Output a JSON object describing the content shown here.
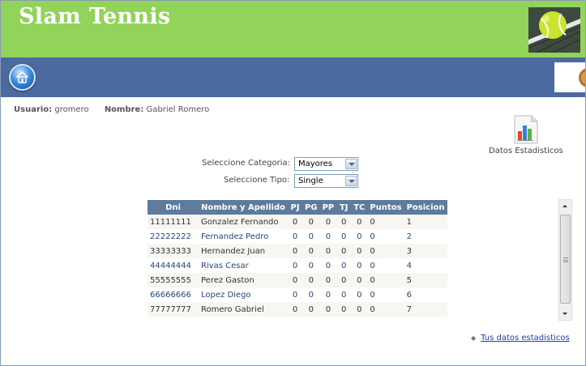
{
  "header": {
    "title": "Slam Tennis",
    "image_icon": "tennis-ball-image"
  },
  "nav": {
    "home_icon": "home-icon",
    "right_image_icon": "tennis-image-partial"
  },
  "user": {
    "usuario_label": "Usuario:",
    "usuario_value": "gromero",
    "nombre_label": "Nombre:",
    "nombre_value": "Gabriel Romero"
  },
  "stats": {
    "icon": "bar-chart-document-icon",
    "caption": "Datos Estadisticos"
  },
  "filters": {
    "categoria_label": "Seleccione Categoria:",
    "categoria_value": "Mayores",
    "tipo_label": "Seleccione Tipo:",
    "tipo_value": "Single"
  },
  "table": {
    "columns": [
      "Dni",
      "Nombre y Apellido",
      "PJ",
      "PG",
      "PP",
      "TJ",
      "TC",
      "Puntos",
      "Posicion"
    ],
    "rows": [
      [
        "11111111",
        "Gonzalez Fernando",
        "0",
        "0",
        "0",
        "0",
        "0",
        "0",
        "1"
      ],
      [
        "22222222",
        "Fernandez Pedro",
        "0",
        "0",
        "0",
        "0",
        "0",
        "0",
        "2"
      ],
      [
        "33333333",
        "Hernandez Juan",
        "0",
        "0",
        "0",
        "0",
        "0",
        "0",
        "3"
      ],
      [
        "44444444",
        "Rivas Cesar",
        "0",
        "0",
        "0",
        "0",
        "0",
        "0",
        "4"
      ],
      [
        "55555555",
        "Perez Gaston",
        "0",
        "0",
        "0",
        "0",
        "0",
        "0",
        "5"
      ],
      [
        "66666666",
        "Lopez Diego",
        "0",
        "0",
        "0",
        "0",
        "0",
        "0",
        "6"
      ],
      [
        "77777777",
        "Romero Gabriel",
        "0",
        "0",
        "0",
        "0",
        "0",
        "0",
        "7"
      ]
    ]
  },
  "footer": {
    "link_text": "Tus datos estadisticos"
  },
  "colors": {
    "header_green": "#92d35a",
    "nav_blue": "#4a6aa0",
    "table_header": "#5d7b9d",
    "link_blue": "#1f3fa6"
  }
}
